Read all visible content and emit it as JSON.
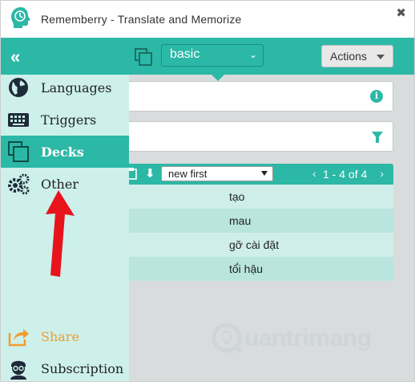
{
  "window": {
    "title": "Rememberry - Translate and Memorize",
    "close_label": "✖"
  },
  "sidebar": {
    "collapse_label": "«",
    "items": [
      {
        "label": "Languages"
      },
      {
        "label": "Triggers"
      },
      {
        "label": "Decks"
      },
      {
        "label": "Other"
      }
    ],
    "footer": [
      {
        "label": "Share"
      },
      {
        "label": "Subscription"
      }
    ]
  },
  "toolbar": {
    "deck_value": "basic",
    "actions_label": "Actions"
  },
  "list": {
    "sort_arrow": "⬇",
    "sort_value": "new first",
    "pager_prev": "‹",
    "pager_text": "1 - 4 of 4",
    "pager_next": "›",
    "rows": [
      "tạo",
      "mau",
      "gỡ cài đặt",
      "tố́i hậu"
    ]
  },
  "watermark": {
    "text": "uantrimang"
  },
  "colors": {
    "accent": "#2cb8a6",
    "sidebar_bg": "#cdf0eb",
    "row_a": "#cfeee9",
    "row_b": "#b9e5de",
    "share_orange": "#f39c2b",
    "arrow_red": "#e8141b"
  }
}
